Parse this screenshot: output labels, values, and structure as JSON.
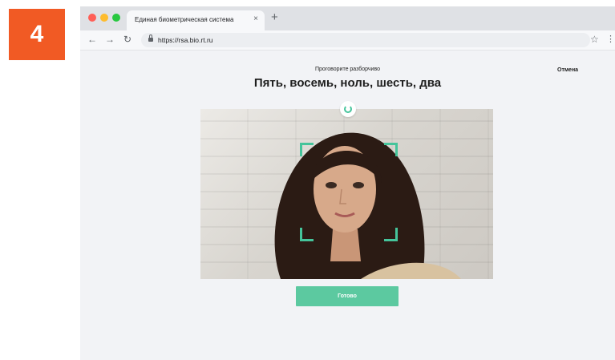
{
  "step": {
    "number": "4",
    "color": "#f15a24"
  },
  "browser": {
    "tab": {
      "title": "Единая биометрическая система",
      "close": "×"
    },
    "new_tab": "+",
    "nav": {
      "back": "←",
      "forward": "→",
      "reload": "↻"
    },
    "url": "https://rsa.bio.rt.ru",
    "icons": [
      "lock-icon",
      "star-icon",
      "kebab-menu-icon"
    ]
  },
  "page": {
    "instruction": "Проговорите разборчиво",
    "phrase": "Пять, восемь, ноль, шесть, два",
    "cancel_label": "Отмена",
    "ready_label": "Готово",
    "accent_color": "#45c49b",
    "button_color": "#5cc9a0"
  }
}
